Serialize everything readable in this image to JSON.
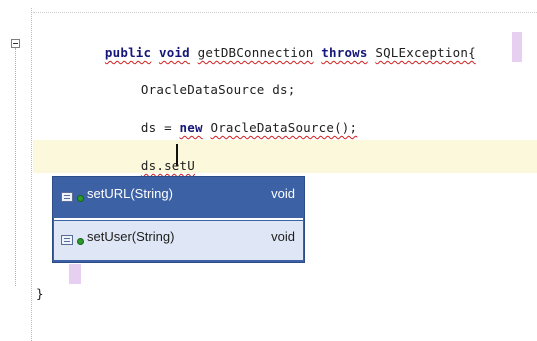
{
  "editor": {
    "lines": {
      "line1_kw1": "public",
      "line1_kw2": "void",
      "line1_method": "getDBConnection",
      "line1_kw3": "throws",
      "line1_exc": "SQLException{",
      "line2": "OracleDataSource ds;",
      "line3_pre": "ds = ",
      "line3_kw": "new",
      "line3_post": "OracleDataSource();",
      "line4": "ds.setU",
      "closing_brace": "}"
    },
    "colors": {
      "keyword": "#16167a",
      "current_line": "#fbf8dc",
      "popup_selected": "#3c61a5",
      "squiggle": "#d02020"
    }
  },
  "completion_popup": {
    "items": [
      {
        "name": "setURL(String)",
        "return_type": "void",
        "icon": "method-icon",
        "selected": true
      },
      {
        "name": "setUser(String)",
        "return_type": "void",
        "icon": "method-icon",
        "selected": false
      }
    ]
  }
}
